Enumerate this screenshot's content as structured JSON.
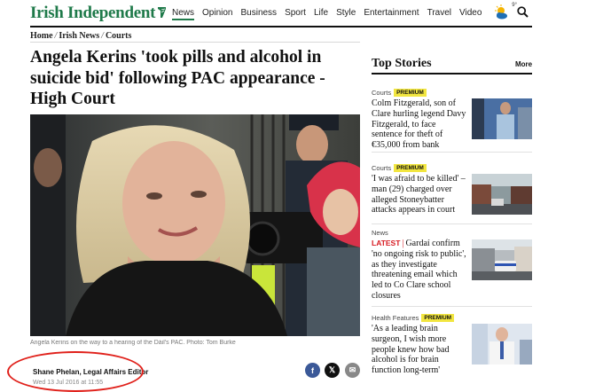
{
  "header": {
    "logo_text": "Irish Independent",
    "brand_color": "#1f7a4a",
    "nav": [
      "News",
      "Opinion",
      "Business",
      "Sport",
      "Life",
      "Style",
      "Entertainment",
      "Travel",
      "Video"
    ],
    "active_nav": "News",
    "weather_temp": "9°",
    "weather_icon": "sun-cloud-icon",
    "search_icon": "search-icon"
  },
  "breadcrumb": [
    "Home",
    "Irish News",
    "Courts"
  ],
  "article": {
    "headline": "Angela Kerins 'took pills and alcohol in suicide bid' following PAC appearance - High Court",
    "caption": "Angela Kerins on the way to a hearing of the Dáil's PAC. Photo: Tom Burke",
    "author": "Shane Phelan, Legal Affairs Editor",
    "date": "Wed 13 Jul 2016 at 11:55",
    "share": {
      "facebook": "f",
      "x": "𝕏",
      "email": "✉"
    },
    "highlight_color": "#e0201a"
  },
  "sidebar": {
    "title": "Top Stories",
    "more_label": "More",
    "premium_label": "PREMIUM",
    "stories": [
      {
        "category": "Courts",
        "premium": true,
        "latest": "",
        "title": "Colm Fitzgerald, son of Clare hurling legend Davy Fitzgerald, to face sentence for theft of €35,000 from bank"
      },
      {
        "category": "Courts",
        "premium": true,
        "latest": "",
        "title": "'I was afraid to be killed' – man (29) charged over alleged Stoneybatter attacks appears in court"
      },
      {
        "category": "News",
        "premium": false,
        "latest": "LATEST",
        "title": "Gardaí confirm 'no ongoing risk to public', as they investigate threatening email which led to Co Clare school closures"
      },
      {
        "category": "Health Features",
        "premium": true,
        "latest": "",
        "title": "'As a leading brain surgeon, I wish more people knew how bad alcohol is for brain function long-term'"
      }
    ]
  }
}
